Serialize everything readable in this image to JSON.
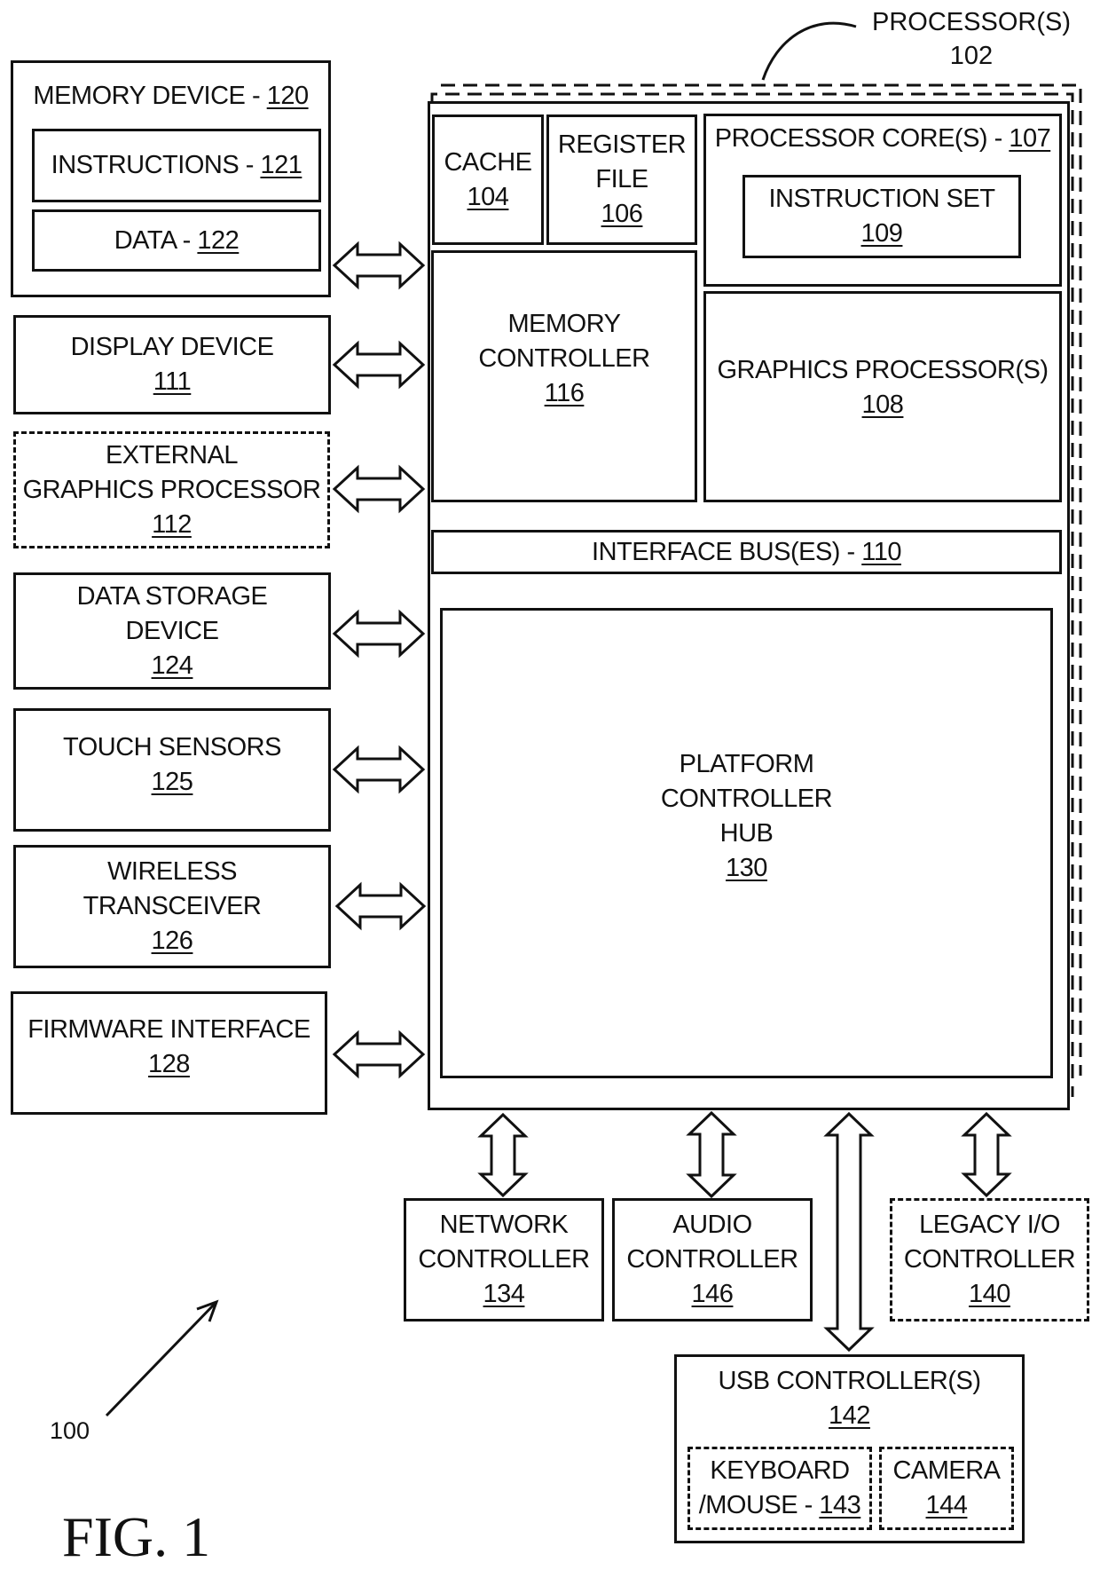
{
  "figure": {
    "title": "FIG. 1",
    "system_ref": "100"
  },
  "processor": {
    "label": "PROCESSOR(S)",
    "ref": "102",
    "cache": {
      "label": "CACHE",
      "ref": "104"
    },
    "register_file": {
      "label_line1": "REGISTER",
      "label_line2": "FILE",
      "ref": "106"
    },
    "cores": {
      "label": "PROCESSOR CORE(S) - ",
      "ref": "107"
    },
    "instruction_set": {
      "label": "INSTRUCTION SET",
      "ref": "109"
    },
    "memory_controller": {
      "label_line1": "MEMORY",
      "label_line2": "CONTROLLER",
      "ref": "116"
    },
    "graphics": {
      "label": "GRAPHICS PROCESSOR(S)",
      "ref": "108"
    },
    "interface_bus": {
      "label": "INTERFACE BUS(ES) - ",
      "ref": "110"
    },
    "pch": {
      "label_line1": "PLATFORM",
      "label_line2": "CONTROLLER",
      "label_line3": "HUB",
      "ref": "130"
    }
  },
  "left_devices": {
    "memory_device": {
      "label": "MEMORY DEVICE - ",
      "ref": "120",
      "instructions": {
        "label": "INSTRUCTIONS - ",
        "ref": "121"
      },
      "data": {
        "label": "DATA - ",
        "ref": "122"
      }
    },
    "display_device": {
      "label": "DISPLAY DEVICE",
      "ref": "111"
    },
    "external_graphics": {
      "label_line1": "EXTERNAL",
      "label_line2": "GRAPHICS PROCESSOR",
      "ref": "112",
      "optional": true
    },
    "data_storage": {
      "label_line1": "DATA STORAGE",
      "label_line2": "DEVICE",
      "ref": "124"
    },
    "touch_sensors": {
      "label": "TOUCH SENSORS",
      "ref": "125"
    },
    "wireless": {
      "label_line1": "WIRELESS",
      "label_line2": "TRANSCEIVER",
      "ref": "126"
    },
    "firmware": {
      "label": "FIRMWARE INTERFACE",
      "ref": "128"
    }
  },
  "bottom_devices": {
    "network": {
      "label_line1": "NETWORK",
      "label_line2": "CONTROLLER",
      "ref": "134"
    },
    "audio": {
      "label_line1": "AUDIO",
      "label_line2": "CONTROLLER",
      "ref": "146"
    },
    "legacy_io": {
      "label_line1": "LEGACY I/O",
      "label_line2": "CONTROLLER",
      "ref": "140",
      "optional": true
    },
    "usb": {
      "label": "USB CONTROLLER(S)",
      "ref": "142",
      "keyboard_mouse": {
        "label_line1": "KEYBOARD",
        "label_line2": "/MOUSE - ",
        "ref": "143",
        "optional": true
      },
      "camera": {
        "label": "CAMERA",
        "ref": "144",
        "optional": true
      }
    }
  },
  "colors": {
    "ink": "#111111",
    "paper": "#ffffff"
  }
}
